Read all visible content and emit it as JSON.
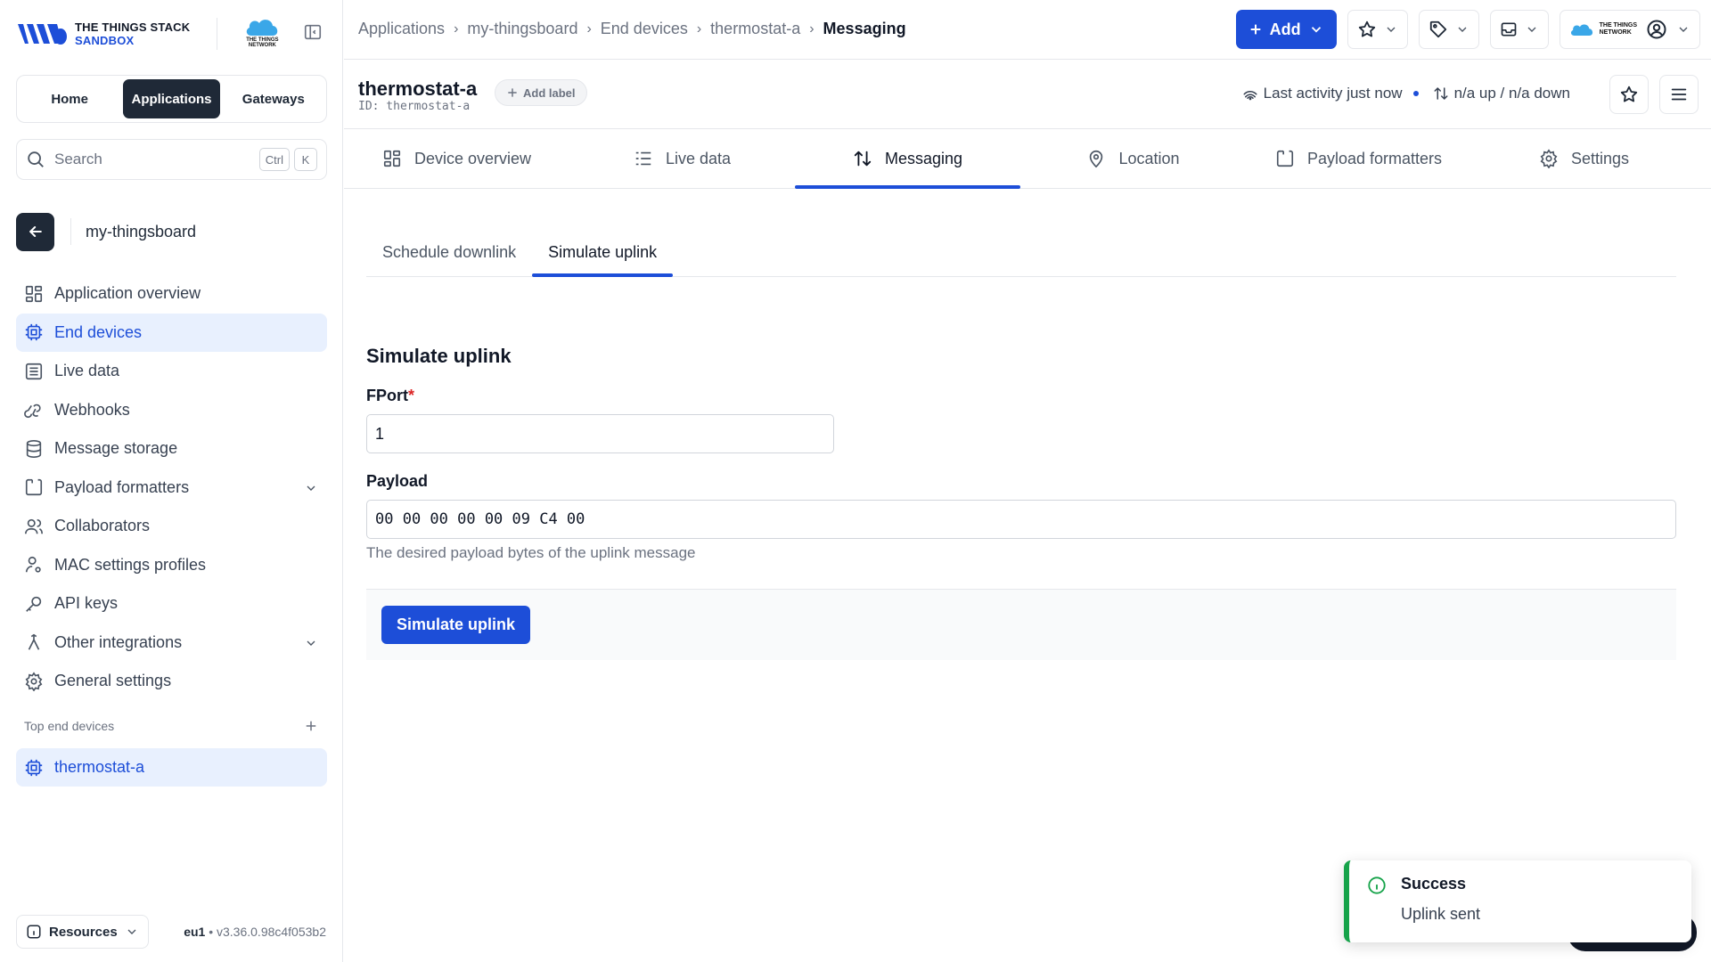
{
  "brand": {
    "line1": "THE THINGS STACK",
    "line2": "SANDBOX",
    "ttn_line1": "THE THINGS",
    "ttn_line2": "NETWORK"
  },
  "switcher": [
    "Home",
    "Applications",
    "Gateways"
  ],
  "switcher_active": "Applications",
  "search": {
    "placeholder": "Search",
    "key1": "Ctrl",
    "key2": "K"
  },
  "application": {
    "name": "my-thingsboard"
  },
  "nav": [
    {
      "label": "Application overview",
      "icon": "overview-icon"
    },
    {
      "label": "End devices",
      "icon": "chip-icon",
      "active": true
    },
    {
      "label": "Live data",
      "icon": "list-icon"
    },
    {
      "label": "Webhooks",
      "icon": "webhook-icon"
    },
    {
      "label": "Message storage",
      "icon": "database-icon"
    },
    {
      "label": "Payload formatters",
      "icon": "code-icon",
      "expandable": true
    },
    {
      "label": "Collaborators",
      "icon": "users-icon"
    },
    {
      "label": "MAC settings profiles",
      "icon": "user-cog-icon"
    },
    {
      "label": "API keys",
      "icon": "key-icon"
    },
    {
      "label": "Other integrations",
      "icon": "integrations-icon",
      "expandable": true
    },
    {
      "label": "General settings",
      "icon": "gear-icon"
    }
  ],
  "top_devices": {
    "header": "Top end devices",
    "items": [
      "thermostat-a"
    ]
  },
  "footer": {
    "resources": "Resources",
    "cluster": "eu1",
    "version": "v3.36.0.98c4f053b2"
  },
  "breadcrumbs": [
    "Applications",
    "my-thingsboard",
    "End devices",
    "thermostat-a",
    "Messaging"
  ],
  "topbar": {
    "add_label": "Add",
    "user_logo_text1": "THE THINGS",
    "user_logo_text2": "NETWORK"
  },
  "device": {
    "title": "thermostat-a",
    "id_line": "ID: thermostat-a",
    "add_label": "Add label",
    "last_activity": "Last activity just now",
    "traffic": "n/a up / n/a down"
  },
  "tabs": [
    {
      "label": "Device overview",
      "icon": "overview-icon"
    },
    {
      "label": "Live data",
      "icon": "list-icon"
    },
    {
      "label": "Messaging",
      "icon": "arrows-up-down-icon",
      "active": true
    },
    {
      "label": "Location",
      "icon": "location-pin-icon"
    },
    {
      "label": "Payload formatters",
      "icon": "code-icon"
    },
    {
      "label": "Settings",
      "icon": "gear-icon"
    }
  ],
  "subtabs": [
    "Schedule downlink",
    "Simulate uplink"
  ],
  "subtab_active": "Simulate uplink",
  "form": {
    "title": "Simulate uplink",
    "fport_label": "FPort",
    "fport_value": "1",
    "payload_label": "Payload",
    "payload_value": "00 00 00 00 00 09 C4 00",
    "payload_hint": "The desired payload bytes of the uplink message",
    "submit_label": "Simulate uplink"
  },
  "toast": {
    "title": "Success",
    "message": "Uplink sent",
    "accent": "#16a34a"
  },
  "colors": {
    "primary": "#1d4ed8",
    "dark": "#1f2937",
    "active_bg": "#e8f0fe"
  }
}
